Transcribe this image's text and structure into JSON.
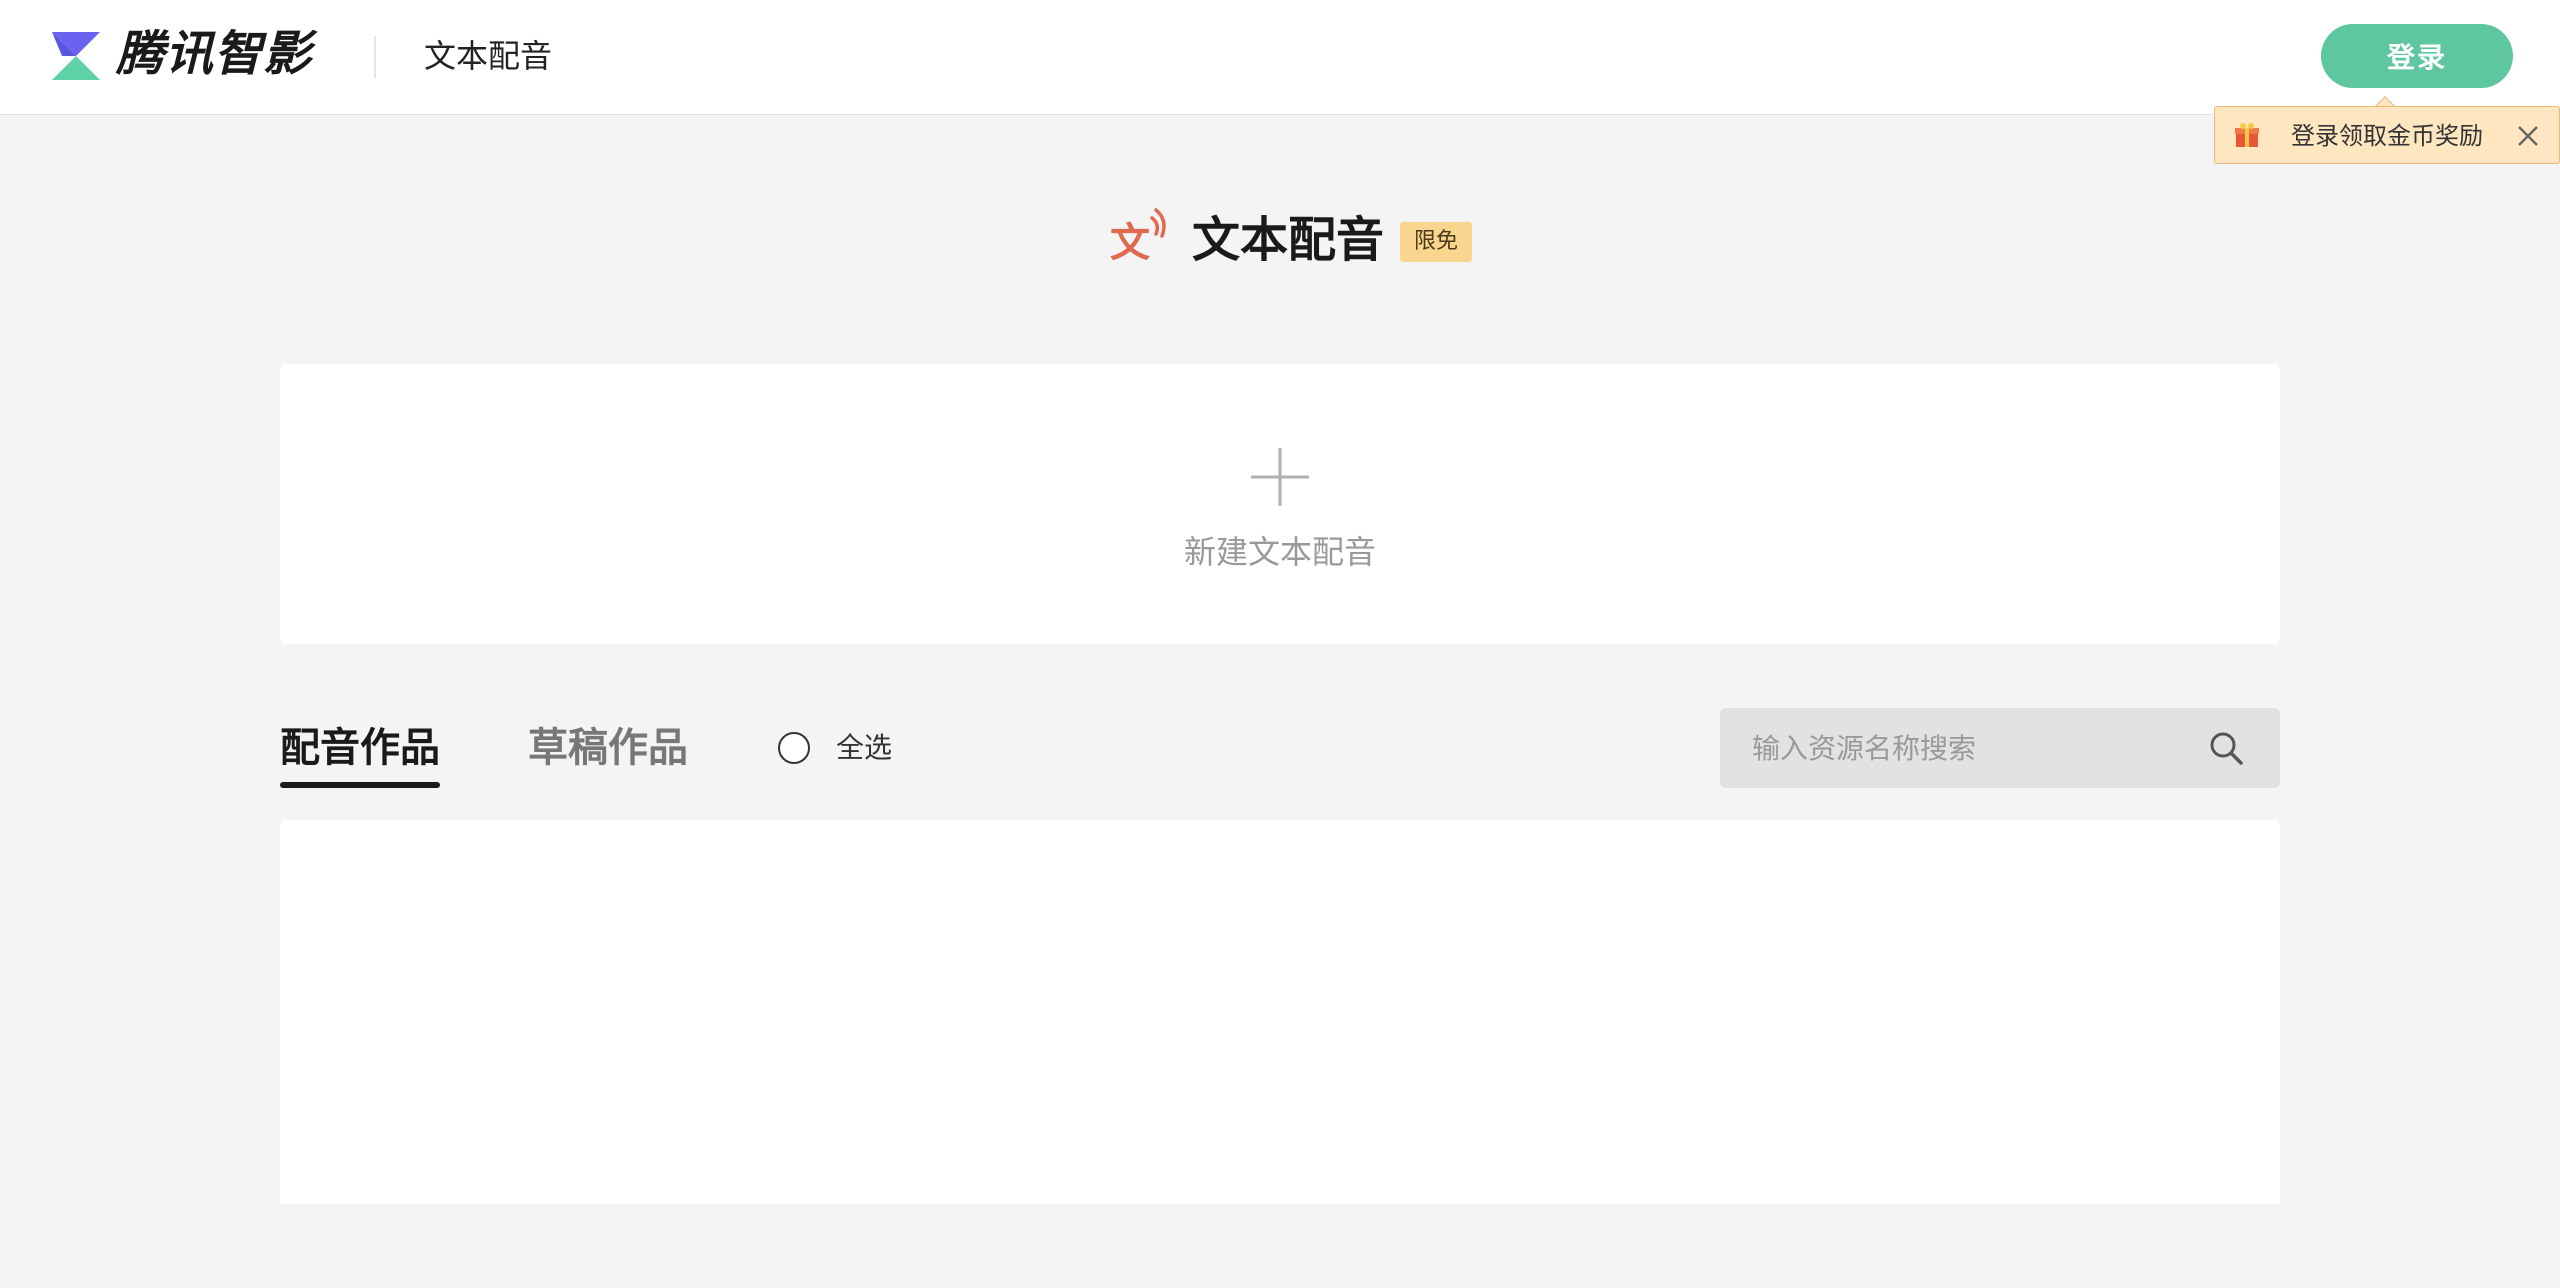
{
  "header": {
    "brand": "腾讯智影",
    "page_name": "文本配音",
    "login_label": "登录"
  },
  "reward_tip": {
    "text": "登录领取金币奖励"
  },
  "title": {
    "text": "文本配音",
    "badge": "限免"
  },
  "new_card": {
    "label": "新建文本配音"
  },
  "tabs": [
    {
      "label": "配音作品",
      "active": true
    },
    {
      "label": "草稿作品",
      "active": false
    }
  ],
  "select_all": {
    "label": "全选",
    "checked": false
  },
  "search": {
    "placeholder": "输入资源名称搜索",
    "value": ""
  },
  "colors": {
    "accent": "#5ec7a0",
    "badge": "#fad58f",
    "reward_bg": "#fde6c0",
    "title_icon": "#e06a4f"
  },
  "icons": [
    "app-logo-icon",
    "gift-icon",
    "close-icon",
    "text-voice-icon",
    "plus-icon",
    "search-icon"
  ]
}
